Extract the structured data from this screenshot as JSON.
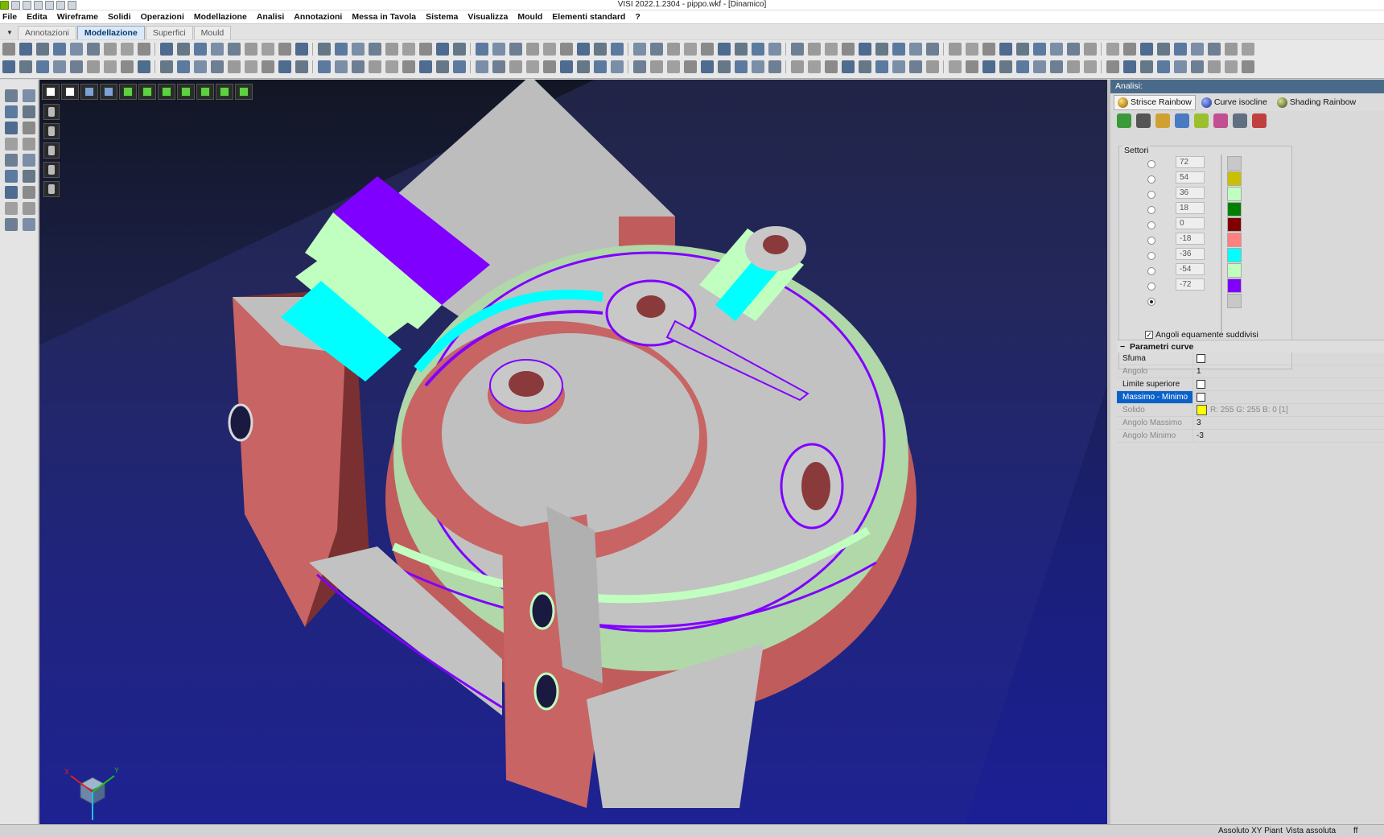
{
  "window": {
    "title": "VISI 2022.1.2304 - pippo.wkf - [Dinamico]"
  },
  "menu": [
    "File",
    "Edita",
    "Wireframe",
    "Solidi",
    "Operazioni",
    "Modellazione",
    "Analisi",
    "Annotazioni",
    "Messa in Tavola",
    "Sistema",
    "Visualizza",
    "Mould",
    "Elementi standard",
    "?"
  ],
  "ribbon_tabs": [
    {
      "label": "Annotazioni",
      "active": false
    },
    {
      "label": "Modellazione",
      "active": true
    },
    {
      "label": "Superfici",
      "active": false
    },
    {
      "label": "Mould",
      "active": false
    }
  ],
  "panel": {
    "header": "Analisi:",
    "tabs": [
      {
        "label": "Strisce Rainbow",
        "active": true,
        "icon": "rainbow-stripes-icon",
        "color": "#c8a030"
      },
      {
        "label": "Curve isocline",
        "active": false,
        "icon": "isocline-sphere-icon",
        "color": "#3b55c9"
      },
      {
        "label": "Shading Rainbow",
        "active": false,
        "icon": "shading-sphere-icon",
        "color": "#6a8a30"
      }
    ],
    "settori": {
      "label": "Settori",
      "values": [
        "72",
        "54",
        "36",
        "18",
        "0",
        "-18",
        "-36",
        "-54",
        "-72"
      ],
      "selected_index": 9,
      "colors": [
        "#c8c8c8",
        "#c8c000",
        "#c0ffc0",
        "#008000",
        "#800000",
        "#ff8080",
        "#00ffff",
        "#c0ffc0",
        "#8000ff",
        "#c8c8c8"
      ],
      "equi_label": "Angoli equamente suddivisi",
      "equi_checked": true
    },
    "params": {
      "title": "Parametri curve",
      "rows": [
        {
          "label": "Sfuma",
          "type": "check",
          "value": ""
        },
        {
          "label": "Angolo",
          "type": "text",
          "value": "1",
          "disabled": true
        },
        {
          "label": "Limite superiore",
          "type": "check",
          "value": ""
        },
        {
          "label": "Massimo - Minimo",
          "type": "check",
          "value": "",
          "highlight": true
        },
        {
          "label": "Solido",
          "type": "color",
          "value": "R: 255 G: 255 B: 0 [1]",
          "color": "#ffff00",
          "disabled": true
        },
        {
          "label": "Angolo Massimo",
          "type": "text",
          "value": "3",
          "disabled": true
        },
        {
          "label": "Angolo Minimo",
          "type": "text",
          "value": "-3",
          "disabled": true
        }
      ]
    }
  },
  "status": {
    "view_plane": "Assoluto XY Piant",
    "view": "Vista assoluta",
    "extra": "ff"
  },
  "axis_labels": {
    "x": "X",
    "y": "Y",
    "z": "Z"
  }
}
